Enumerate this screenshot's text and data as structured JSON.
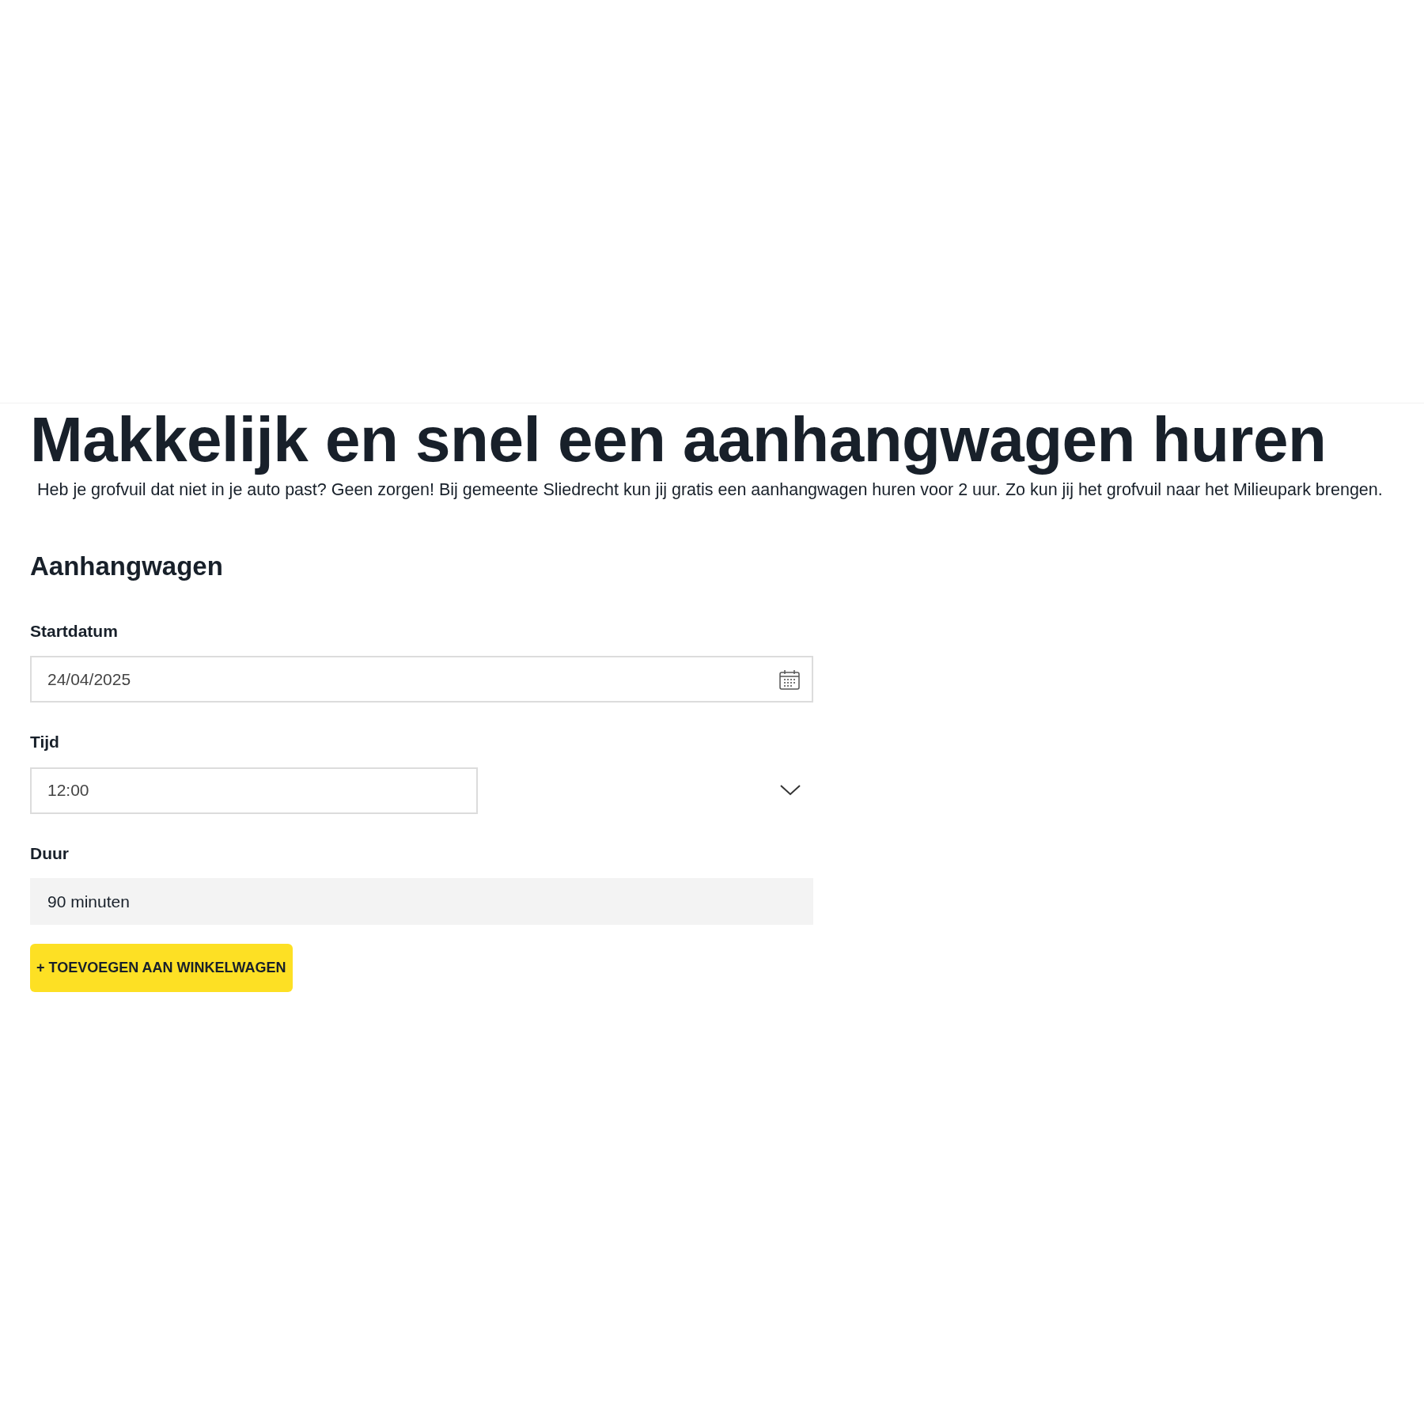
{
  "heading": "Makkelijk en snel een aanhangwagen huren",
  "intro": "Heb je grofvuil dat niet in je auto past? Geen zorgen! Bij gemeente Sliedrecht kun jij gratis een aanhangwagen huren voor 2 uur. Zo kun jij het grofvuil naar het Milieupark brengen.",
  "section_title": "Aanhangwagen",
  "fields": [
    {
      "kind": "date",
      "label": "Startdatum",
      "value": "24/04/2025"
    },
    {
      "kind": "select",
      "label": "Tijd",
      "value": "12:00"
    },
    {
      "kind": "readonly",
      "label": "Duur",
      "value": "90 minuten"
    }
  ],
  "button": "+ TOEVOEGEN AAN WINKELWAGEN"
}
